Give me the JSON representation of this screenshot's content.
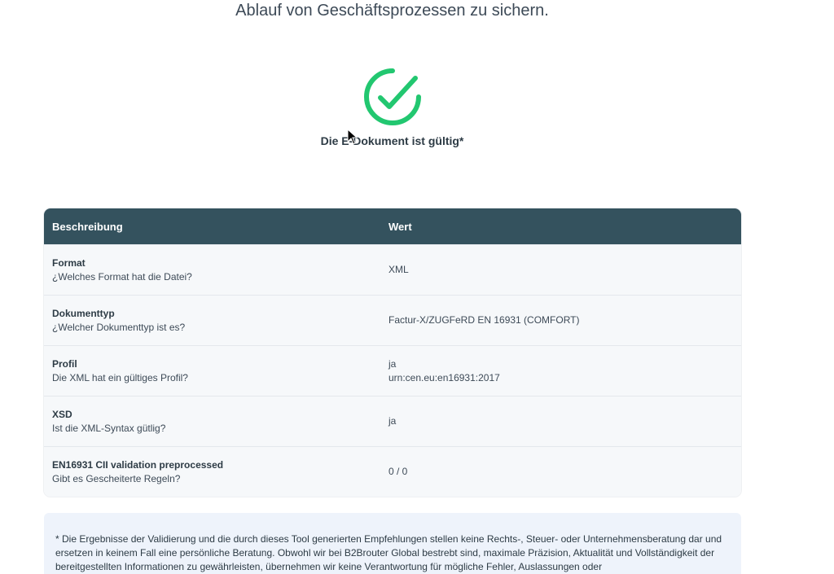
{
  "intro": {
    "text": "Ablauf von Geschäftsprozessen zu sichern."
  },
  "status": {
    "icon": "check-circle-icon",
    "color": "#22c770",
    "text": "Die E-Dokument ist gültig*"
  },
  "table": {
    "header": {
      "description": "Beschreibung",
      "value": "Wert"
    },
    "header_color": "#34525e",
    "rows": [
      {
        "name": "Format",
        "question": "¿Welches Format hat die Datei?",
        "value": "XML",
        "value2": ""
      },
      {
        "name": "Dokumenttyp",
        "question": "¿Welcher Dokumenttyp ist es?",
        "value": "Factur-X/ZUGFeRD EN 16931 (COMFORT)",
        "value2": ""
      },
      {
        "name": "Profil",
        "question": "Die XML hat ein gültiges Profil?",
        "value": "ja",
        "value2": "urn:cen.eu:en16931:2017"
      },
      {
        "name": "XSD",
        "question": "Ist die XML-Syntax gütlig?",
        "value": "ja",
        "value2": ""
      },
      {
        "name": "EN16931 CII validation preprocessed",
        "question": "Gibt es Gescheiterte Regeln?",
        "value": "0 / 0",
        "value2": ""
      }
    ]
  },
  "disclaimer": {
    "text": "* Die Ergebnisse der Validierung und die durch dieses Tool generierten Empfehlungen stellen keine Rechts-, Steuer- oder Unternehmensberatung dar und ersetzen in keinem Fall eine persönliche Beratung. Obwohl wir bei B2Brouter Global bestrebt sind, maximale Präzision, Aktualität und Vollständigkeit der bereitgestellten Informationen zu gewährleisten, übernehmen wir keine Verantwortung für mögliche Fehler, Auslassungen oder"
  }
}
